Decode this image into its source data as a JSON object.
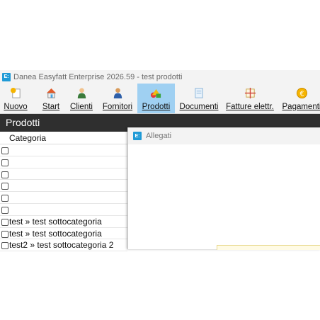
{
  "window": {
    "title": "Danea Easyfatt Enterprise  2026.59  -  test prodotti",
    "app_icon": "E:"
  },
  "toolbar": {
    "buttons": [
      {
        "label": "Nuovo",
        "icon": "new-icon"
      },
      {
        "label": "Start",
        "icon": "home-icon"
      },
      {
        "label": "Clienti",
        "icon": "customer-icon"
      },
      {
        "label": "Fornitori",
        "icon": "supplier-icon"
      },
      {
        "label": "Prodotti",
        "icon": "products-icon",
        "active": true
      },
      {
        "label": "Documenti",
        "icon": "documents-icon"
      },
      {
        "label": "Fatture elettr.",
        "icon": "einvoice-icon"
      },
      {
        "label": "Pagamenti",
        "icon": "payments-icon"
      }
    ]
  },
  "section": {
    "title": "Prodotti"
  },
  "list": {
    "column_header": "Categoria",
    "rows": [
      "",
      "",
      "",
      "",
      "",
      "",
      "test  »  test sottocategoria",
      "test  »  test sottocategoria",
      "test2  »  test sottocategoria 2"
    ]
  },
  "dialog": {
    "title": "Allegati",
    "app_icon": "E:"
  },
  "colors": {
    "accent": "#9fd0f2",
    "header_bg": "#2f2f2f",
    "app_icon": "#1f9ad6"
  }
}
